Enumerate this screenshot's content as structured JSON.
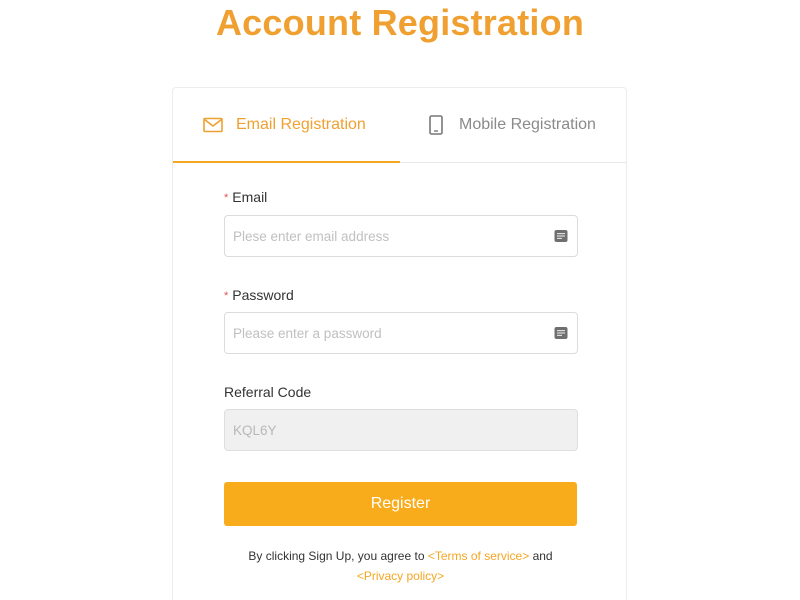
{
  "page": {
    "title": "Account Registration"
  },
  "tabs": [
    {
      "label": "Email Registration",
      "icon": "envelope-icon",
      "active": true
    },
    {
      "label": "Mobile Registration",
      "icon": "mobile-phone-icon",
      "active": false
    }
  ],
  "form": {
    "email": {
      "required_mark": "*",
      "label": "Email",
      "placeholder": "Plese enter email address",
      "value": ""
    },
    "password": {
      "required_mark": "*",
      "label": "Password",
      "placeholder": "Please enter a password",
      "value": ""
    },
    "referral": {
      "label": "Referral Code",
      "value": "KQL6Y"
    },
    "register_label": "Register"
  },
  "agreement": {
    "prefix": "By clicking Sign Up, you agree to",
    "terms_link": "<Terms of service>",
    "conjunction": "and",
    "privacy_link": "<Privacy policy>"
  },
  "colors": {
    "accent": "#f5a623",
    "title": "#f0a030",
    "button": "#f9ac1b",
    "required": "#e0504f",
    "readonly_bg": "#f0f0f0"
  }
}
